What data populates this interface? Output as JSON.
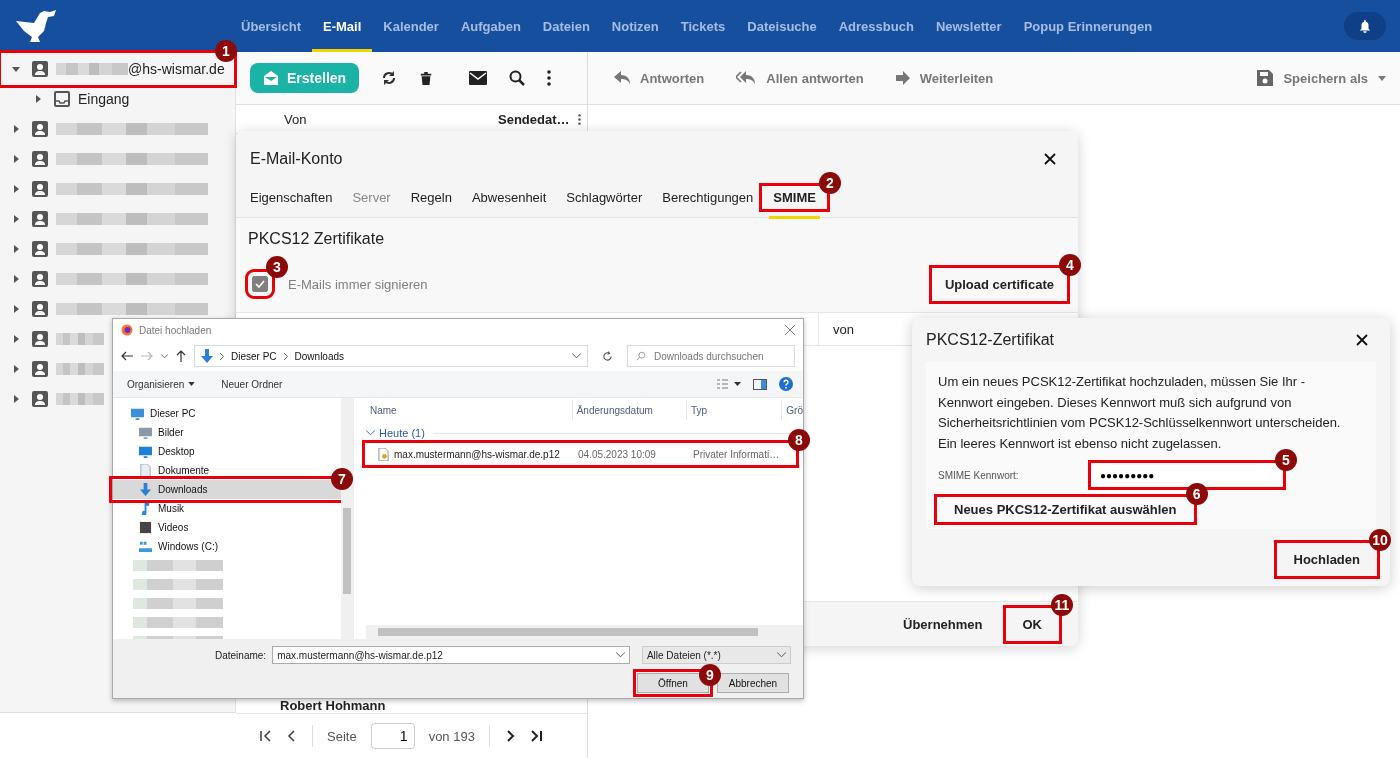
{
  "nav": {
    "tabs": [
      {
        "label": "Übersicht",
        "selected": false
      },
      {
        "label": "E-Mail",
        "selected": true
      },
      {
        "label": "Kalender",
        "selected": false
      },
      {
        "label": "Aufgaben",
        "selected": false
      },
      {
        "label": "Dateien",
        "selected": false
      },
      {
        "label": "Notizen",
        "selected": false
      },
      {
        "label": "Tickets",
        "selected": false
      },
      {
        "label": "Dateisuche",
        "selected": false
      },
      {
        "label": "Adressbuch",
        "selected": false
      },
      {
        "label": "Newsletter",
        "selected": false
      },
      {
        "label": "Popup Erinnerungen",
        "selected": false
      }
    ]
  },
  "sidebar": {
    "accounts": [
      {
        "label": "@hs-wismar.de",
        "expanded": true,
        "marker": "1",
        "children": [
          {
            "label": "Eingang",
            "expanded": false
          }
        ]
      },
      {
        "expanded": false
      },
      {
        "expanded": false
      },
      {
        "expanded": false
      },
      {
        "expanded": false
      },
      {
        "expanded": false
      },
      {
        "expanded": false
      },
      {
        "expanded": false
      },
      {
        "expanded": false
      },
      {
        "expanded": false
      },
      {
        "expanded": false
      }
    ]
  },
  "mail_list": {
    "compose": "Erstellen",
    "columns": [
      "Von",
      "Sendedat…"
    ],
    "rows": [
      {
        "from": "Robert Hohmann"
      }
    ],
    "pager": {
      "page_label": "Seite",
      "page": "1",
      "of": "von 193"
    }
  },
  "reader": {
    "actions": [
      {
        "kind": "reply",
        "label": "Antworten"
      },
      {
        "kind": "reply-all",
        "label": "Allen antworten"
      },
      {
        "kind": "forward",
        "label": "Weiterleiten"
      }
    ],
    "save_as": "Speichern als"
  },
  "account_dialog": {
    "title": "E-Mail-Konto",
    "tabs": [
      {
        "label": "Eigenschaften",
        "selected": false,
        "disabled": false
      },
      {
        "label": "Server",
        "selected": false,
        "disabled": true
      },
      {
        "label": "Regeln",
        "selected": false,
        "disabled": false
      },
      {
        "label": "Abwesenheit",
        "selected": false,
        "disabled": false
      },
      {
        "label": "Schlagwörter",
        "selected": false,
        "disabled": false
      },
      {
        "label": "Berechtigungen",
        "selected": false,
        "disabled": false
      },
      {
        "label": "SMIME",
        "selected": true,
        "disabled": false,
        "marker": "2"
      }
    ],
    "section": "PKCS12 Zertifikate",
    "sign_checkbox": {
      "label": "E-Mails immer signieren",
      "checked": true,
      "disabled": true,
      "marker": "3"
    },
    "upload_button": {
      "label": "Upload certificate",
      "marker": "4"
    },
    "table": {
      "columns": [
        "von"
      ]
    },
    "buttons": [
      {
        "label": "Übernehmen"
      },
      {
        "label": "OK",
        "marker": "11"
      }
    ]
  },
  "file_dialog": {
    "title": "Datei hochladen",
    "path": [
      "Dieser PC",
      "Downloads"
    ],
    "search": {
      "placeholder": "Downloads durchsuchen"
    },
    "commands": [
      "Organisieren",
      "Neuer Ordner"
    ],
    "nav_items": [
      {
        "kind": "pc",
        "label": "Dieser PC",
        "selected": false
      },
      {
        "kind": "pictures",
        "label": "Bilder",
        "selected": false
      },
      {
        "kind": "desktop",
        "label": "Desktop",
        "selected": false
      },
      {
        "kind": "documents",
        "label": "Dokumente",
        "selected": false
      },
      {
        "kind": "downloads",
        "label": "Downloads",
        "selected": true,
        "marker": "7"
      },
      {
        "kind": "music",
        "label": "Musik",
        "selected": false
      },
      {
        "kind": "videos",
        "label": "Videos",
        "selected": false
      },
      {
        "kind": "drive",
        "label": "Windows (C:)",
        "selected": false
      },
      {
        "kind": "redacted",
        "selected": false
      },
      {
        "kind": "redacted",
        "selected": false
      },
      {
        "kind": "redacted",
        "selected": false
      },
      {
        "kind": "redacted",
        "selected": false
      },
      {
        "kind": "redacted",
        "selected": false
      }
    ],
    "columns": [
      "Name",
      "Änderungsdatum",
      "Typ",
      "Grö"
    ],
    "group": "Heute (1)",
    "files": [
      {
        "name": "max.mustermann@hs-wismar.de.p12",
        "date": "04.05.2023 10:09",
        "type": "Privater Informati…",
        "marker": "8"
      }
    ],
    "filename_label": "Dateiname:",
    "filename": "max.mustermann@hs-wismar.de.p12",
    "filetype": "Alle Dateien (*.*)",
    "buttons": [
      {
        "label": "Öffnen",
        "marker": "9"
      },
      {
        "label": "Abbrechen"
      }
    ]
  },
  "pkcs_dialog": {
    "title": "PKCS12-Zertifikat",
    "text": "Um ein neues PCSK12-Zertifikat hochzuladen, müssen Sie Ihr -Kennwort eingeben. Dieses Kennwort muß sich aufgrund von Sicherheitsrichtlinien vom PCSK12-Schlüsselkennwort unterscheiden. Ein leeres Kennwort ist ebenso nicht zugelassen.",
    "password_label": "SMIME Kennwort:",
    "password": "●●●●●●●●●",
    "password_marker": "5",
    "select_button": {
      "label": "Neues PKCS12-Zertifikat auswählen",
      "marker": "6"
    },
    "upload_button": {
      "label": "Hochladen",
      "marker": "10"
    }
  }
}
